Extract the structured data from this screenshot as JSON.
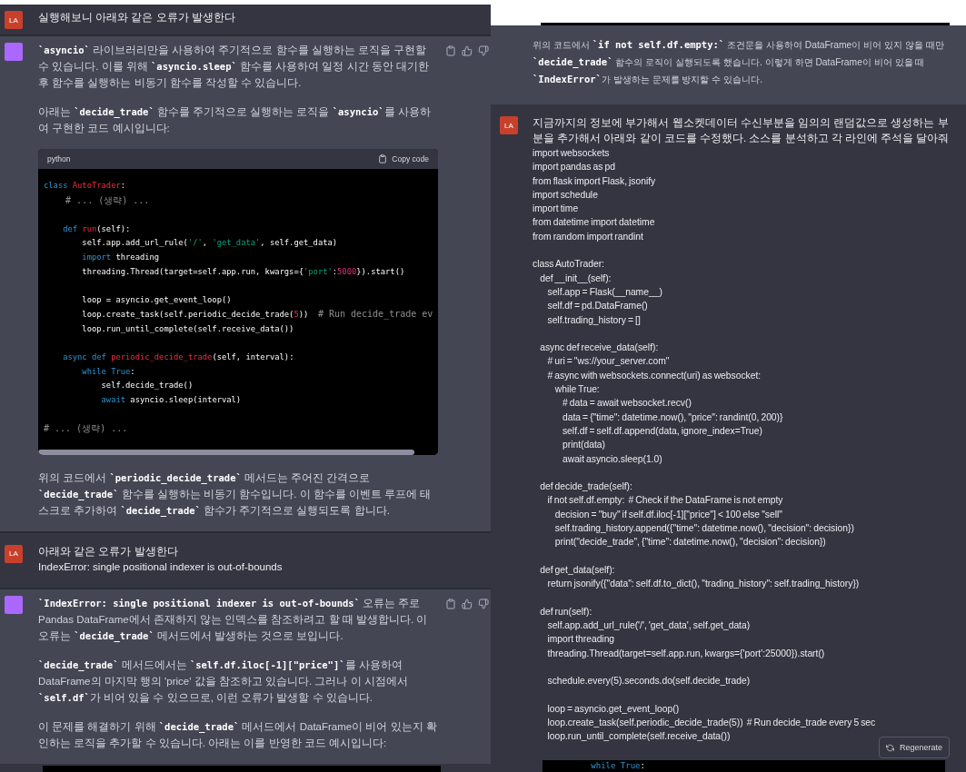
{
  "left_pane": {
    "messages": [
      {
        "kind": "user",
        "avatar": "LA",
        "parts": [
          {
            "kind": "text",
            "text": "실행해보니 아래와 같은 오류가 발생한다"
          }
        ]
      },
      {
        "kind": "assistant",
        "avatar_shown": true,
        "feedback_icons": true,
        "parts": [
          {
            "kind": "paragraph",
            "text": "**`asyncio`** 라이브러리만을 사용하여 주기적으로 함수를 실행하는 로직을 구현할 수 있습니다. 이를 위해 **`asyncio.sleep`** 함수를 사용하여 일정 시간 동안 대기한 후 함수를 실행하는 비동기 함수를 작성할 수 있습니다."
          },
          {
            "kind": "paragraph",
            "text": "아래는 **`decide_trade`** 함수를 주기적으로 실행하는 로직을 **`asyncio`**를 사용하여 구현한 코드 예시입니다:"
          },
          {
            "kind": "code",
            "language": "python",
            "copy_label": "Copy code",
            "blocks": [
              [
                [
                  {
                    "kind": "keyword",
                    "text": "class "
                  },
                  {
                    "kind": "title",
                    "text": "AutoTrader"
                  },
                  {
                    "kind": "plain",
                    "text": ":"
                  }
                ],
                [
                  {
                    "kind": "comment",
                    "text": "    # ... (생략) ..."
                  }
                ]
              ],
              [
                [
                  {
                    "kind": "keyword",
                    "text": "    def "
                  },
                  {
                    "kind": "title",
                    "text": "run"
                  },
                  {
                    "kind": "plain",
                    "text": "(self):"
                  }
                ],
                [
                  {
                    "kind": "plain",
                    "text": "        self.app.add_url_rule("
                  },
                  {
                    "kind": "string",
                    "text": "'/'"
                  },
                  {
                    "kind": "plain",
                    "text": ", "
                  },
                  {
                    "kind": "string",
                    "text": "'get_data'"
                  },
                  {
                    "kind": "plain",
                    "text": ", self.get_data)"
                  }
                ],
                [
                  {
                    "kind": "keyword",
                    "text": "        import"
                  },
                  {
                    "kind": "plain",
                    "text": " threading"
                  }
                ],
                [
                  {
                    "kind": "plain",
                    "text": "        threading.Thread(target=self.app.run, kwargs={"
                  },
                  {
                    "kind": "string",
                    "text": "'port'"
                  },
                  {
                    "kind": "plain",
                    "text": ":"
                  },
                  {
                    "kind": "number",
                    "text": "5000"
                  },
                  {
                    "kind": "plain",
                    "text": "}).start()"
                  }
                ]
              ],
              [
                [
                  {
                    "kind": "plain",
                    "text": "        loop = asyncio.get_event_loop()"
                  }
                ],
                [
                  {
                    "kind": "plain",
                    "text": "        loop.create_task(self.periodic_decide_trade("
                  },
                  {
                    "kind": "number",
                    "text": "5"
                  },
                  {
                    "kind": "plain",
                    "text": "))  "
                  },
                  {
                    "kind": "comment",
                    "text": "# Run decide_trade ev"
                  }
                ],
                [
                  {
                    "kind": "plain",
                    "text": "        loop.run_until_complete(self.receive_data())"
                  }
                ]
              ],
              [
                [
                  {
                    "kind": "keyword",
                    "text": "    async def "
                  },
                  {
                    "kind": "title",
                    "text": "periodic_decide_trade"
                  },
                  {
                    "kind": "plain",
                    "text": "(self, interval):"
                  }
                ],
                [
                  {
                    "kind": "keyword",
                    "text": "        while True"
                  },
                  {
                    "kind": "plain",
                    "text": ":"
                  }
                ],
                [
                  {
                    "kind": "plain",
                    "text": "            self.decide_trade()"
                  }
                ],
                [
                  {
                    "kind": "keyword",
                    "text": "            await"
                  },
                  {
                    "kind": "plain",
                    "text": " asyncio.sleep(interval)"
                  }
                ]
              ],
              [
                [
                  {
                    "kind": "comment",
                    "text": "# ... (생략) ..."
                  }
                ]
              ]
            ]
          },
          {
            "kind": "paragraph",
            "text": "위의 코드에서 **`periodic_decide_trade`** 메서드는 주어진 간격으로 **`decide_trade`** 함수를 실행하는 비동기 함수입니다. 이 함수를 이벤트 루프에 태스크로 추가하여 **`decide_trade`** 함수가 주기적으로 실행되도록 합니다."
          }
        ]
      },
      {
        "kind": "user",
        "avatar": "LA",
        "parts": [
          {
            "kind": "text",
            "text": "아래와 같은 오류가 발생한다"
          },
          {
            "kind": "text",
            "text": "IndexError: single positional indexer is out-of-bounds"
          }
        ]
      },
      {
        "kind": "assistant",
        "avatar_shown": true,
        "feedback_icons": true,
        "parts": [
          {
            "kind": "paragraph",
            "text": "**`IndexError: single positional indexer is out-of-bounds`** 오류는 주로 Pandas DataFrame에서 존재하지 않는 인덱스를 참조하려고 할 때 발생합니다. 이 오류는 **`decide_trade`** 메서드에서 발생하는 것으로 보입니다."
          },
          {
            "kind": "paragraph",
            "text": "**`decide_trade`** 메서드에서는 **`self.df.iloc[-1][\"price\"]`**를 사용하여 DataFrame의 마지막 행의 'price' 값을 참조하고 있습니다. 그러나 이 시점에서 **`self.df`**가 비어 있을 수 있으므로, 이런 오류가 발생할 수 있습니다."
          },
          {
            "kind": "paragraph",
            "text": "이 문제를 해결하기 위해 **`decide_trade`** 메서드에서 DataFrame이 비어 있는지 확인하는 로직을 추가할 수 있습니다. 아래는 이를 반영한 코드 예시입니다:"
          }
        ]
      }
    ],
    "bottom_fragment": {
      "kind": "code_edge"
    }
  },
  "right_pane": {
    "top_fragment": {
      "kind": "code_edge"
    },
    "messages": [
      {
        "kind": "assistant",
        "avatar_shown": false,
        "feedback_icons": false,
        "parts": [
          {
            "kind": "paragraph",
            "text": "위의 코드에서 **`if not self.df.empty:`** 조건문을 사용하여 DataFrame이 비어 있지 않을 때만 **`decide_trade`** 함수의 로직이 실행되도록 했습니다. 이렇게 하면 DataFrame이 비어 있을 때 **`IndexError`**가 발생하는 문제를 방지할 수 있습니다."
          }
        ]
      },
      {
        "kind": "user",
        "avatar": "LA",
        "parts": [
          {
            "kind": "text",
            "text": "지금까지의 정보에 부가해서 웹소켓데이터 수신부분을 임의의 랜덤값으로 생성하는 부분을 추가해서 아래와 같이 코드를 수정했다. 소스를 분석하고 각 라인에 주석을 달아줘"
          },
          {
            "kind": "plain_code",
            "lines": [
              "import websockets",
              "import pandas as pd",
              "from flask import Flask, jsonify",
              "import schedule",
              "import time",
              "from datetime import datetime",
              "from random import randint"
            ]
          },
          {
            "kind": "plain_code",
            "lines": [
              "class AutoTrader:",
              "    def __init__(self):",
              "        self.app = Flask(__name__)",
              "        self.df = pd.DataFrame()",
              "        self.trading_history = []"
            ]
          },
          {
            "kind": "plain_code",
            "lines": [
              "    async def receive_data(self):",
              "        # uri = \"ws://your_server.com\"",
              "        # async with websockets.connect(uri) as websocket:",
              "            while True:",
              "                # data = await websocket.recv()",
              "                data = {\"time\": datetime.now(), \"price\": randint(0, 200)}",
              "                self.df = self.df.append(data, ignore_index=True)",
              "                print(data)",
              "                await asyncio.sleep(1.0)"
            ]
          },
          {
            "kind": "plain_code",
            "lines": [
              "    def decide_trade(self):",
              "        if not self.df.empty:  # Check if the DataFrame is not empty",
              "            decision = \"buy\" if self.df.iloc[-1][\"price\"] < 100 else \"sell\"",
              "            self.trading_history.append({\"time\": datetime.now(), \"decision\": decision})",
              "            print(\"decide_trade\", {\"time\": datetime.now(), \"decision\": decision})"
            ]
          },
          {
            "kind": "plain_code",
            "lines": [
              "    def get_data(self):",
              "        return jsonify({\"data\": self.df.to_dict(), \"trading_history\": self.trading_history})"
            ]
          },
          {
            "kind": "plain_code",
            "lines": [
              "    def run(self):",
              "        self.app.add_url_rule('/', 'get_data', self.get_data)",
              "        import threading",
              "        threading.Thread(target=self.app.run, kwargs={'port':25000}).start()"
            ]
          },
          {
            "kind": "plain_code",
            "lines": [
              "        schedule.every(5).seconds.do(self.decide_trade)"
            ]
          },
          {
            "kind": "plain_code",
            "lines": [
              "        loop = asyncio.get_event_loop()",
              "        loop.create_task(self.periodic_decide_trade(5))  # Run decide_trade every 5 sec",
              "        loop.run_until_complete(self.receive_data())"
            ]
          }
        ]
      }
    ],
    "bottom_fragment": {
      "kind": "code_edge",
      "lines": [
        [
          {
            "kind": "keyword",
            "text": "        while True"
          },
          {
            "kind": "plain",
            "text": ":"
          }
        ]
      ]
    },
    "regenerate_button": {
      "label": "Regenerate"
    }
  }
}
